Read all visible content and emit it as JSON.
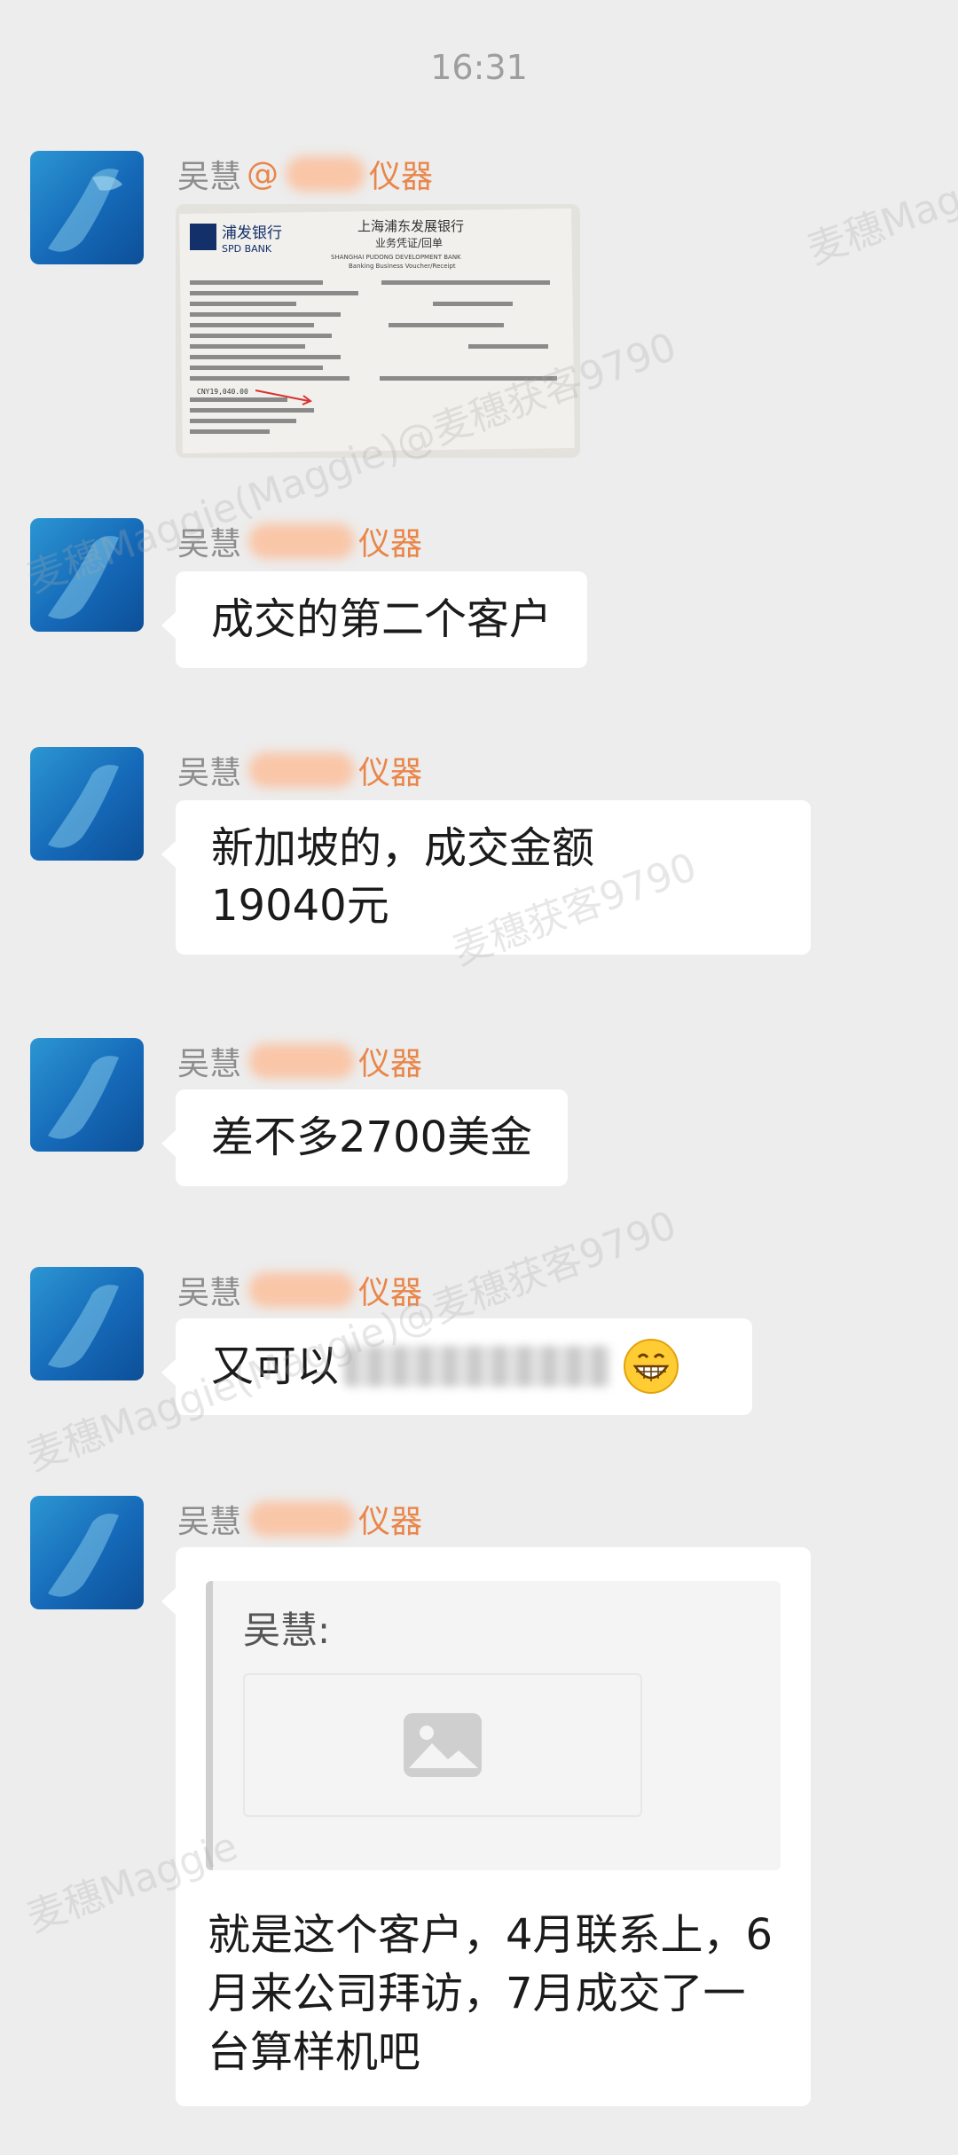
{
  "status": {
    "time": "16:31"
  },
  "messages": [
    {
      "sender": "吴慧",
      "sender_org_prefix": "@",
      "sender_org_suffix": "仪器",
      "type": "image",
      "image": {
        "bank_name_cn": "浦发银行",
        "bank_name_en": "SPD BANK",
        "title_cn": "上海浦东发展银行",
        "subtitle_cn": "业务凭证/回单",
        "title_en": "SHANGHAI PUDONG DEVELOPMENT BANK",
        "subtitle_en": "Banking Business Voucher/Receipt",
        "amount": "CNY19,040.00"
      }
    },
    {
      "sender": "吴慧",
      "sender_org_suffix": "仪器",
      "type": "text",
      "text": "成交的第二个客户"
    },
    {
      "sender": "吴慧",
      "sender_org_suffix": "仪器",
      "type": "text",
      "text_line1": "新加坡的，成交金额",
      "text_line2": "19040元"
    },
    {
      "sender": "吴慧",
      "sender_org_suffix": "仪器",
      "type": "text",
      "text": "差不多2700美金"
    },
    {
      "sender": "吴慧",
      "sender_org_suffix": "仪器",
      "type": "text",
      "text": "又可以",
      "emoji": "grinning-emoji"
    },
    {
      "sender": "吴慧",
      "sender_org_suffix": "仪器",
      "type": "quote-reply",
      "quote_sender": "吴慧:",
      "quote_icon": "image-placeholder-icon",
      "text": "就是这个客户，4月联系上，6月来公司拜访，7月成交了一台算样机吧"
    }
  ],
  "watermark": {
    "text_a": "麦穗Maggie(Maggie)@麦穗获客9790",
    "text_b": "麦穗获客9790",
    "text_c": "麦穗Maggie"
  },
  "colors": {
    "background": "#ededed",
    "bubble": "#ffffff",
    "sender_org": "#e9864a",
    "time": "#9e9e9e"
  }
}
